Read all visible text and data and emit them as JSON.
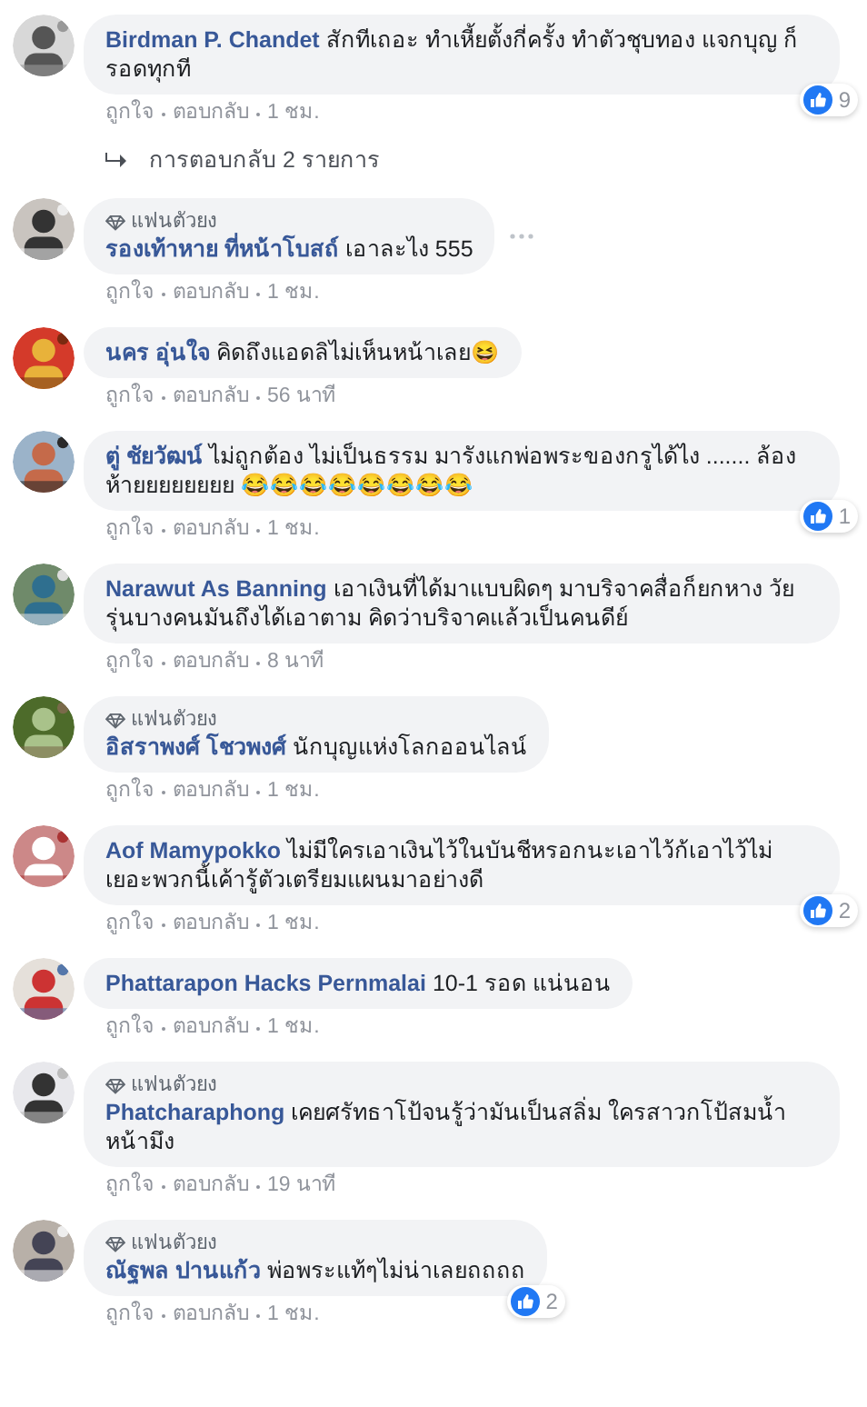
{
  "comments": [
    {
      "name": "Birdman P. Chandet",
      "text": "สักทีเถอะ ทำเหี้ยตั้งกี่ครั้ง ทำตัวชุบทอง แจกบุญ ก็รอดทุกที",
      "likes": "9",
      "options_visible": false,
      "actions": [
        "ถูกใจ",
        "ตอบกลับ",
        "1 ชม."
      ],
      "replies": "การตอบกลับ 2 รายการ"
    },
    {
      "fan_badge": "แฟนตัวยง",
      "name": "รองเท้าหาย ที่หน้าโบสถ์",
      "text": "เอาละไง 555",
      "options_visible": true,
      "actions": [
        "ถูกใจ",
        "ตอบกลับ",
        "1 ชม."
      ]
    },
    {
      "name": "นคร อุ่นใจ",
      "text": "คิดถึงแอดลิไม่เห็นหน้าเลย😆",
      "options_visible": false,
      "actions": [
        "ถูกใจ",
        "ตอบกลับ",
        "56 นาที"
      ]
    },
    {
      "name": "ตู่ ชัยวัฒน์",
      "text": "ไม่ถูกต้อง ไม่เป็นธรรม มารังแกพ่อพระของกรูได้ไง ....... ล้องห้ายยยยยยยย 😂😂😂😂😂😂😂😂",
      "likes": "1",
      "options_visible": false,
      "actions": [
        "ถูกใจ",
        "ตอบกลับ",
        "1 ชม."
      ]
    },
    {
      "name": "Narawut As Banning",
      "text": "เอาเงินที่ได้มาแบบผิดๆ มาบริจาคสื่อก็ยกหาง วัยรุ่นบางคนมันถึงได้เอาตาม คิดว่าบริจาคแล้วเป็นคนดีย์",
      "options_visible": false,
      "actions": [
        "ถูกใจ",
        "ตอบกลับ",
        "8 นาที"
      ]
    },
    {
      "fan_badge": "แฟนตัวยง",
      "name": "อิสราพงศ์ โชวพงศ์",
      "text": "นักบุญแห่งโลกออนไลน์",
      "options_visible": false,
      "actions": [
        "ถูกใจ",
        "ตอบกลับ",
        "1 ชม."
      ]
    },
    {
      "name": "Aof Mamypokko",
      "text": "ไม่มีใครเอาเงินไว้ในบันชีหรอกนะเอาไว้ก้เอาไว้ไม่เยอะพวกนี้เค้ารู้ตัวเตรียมแผนมาอย่างดี",
      "likes": "2",
      "options_visible": false,
      "actions": [
        "ถูกใจ",
        "ตอบกลับ",
        "1 ชม."
      ]
    },
    {
      "name": "Phattarapon Hacks Pernmalai",
      "text": "10-1 รอด แน่นอน",
      "options_visible": false,
      "actions": [
        "ถูกใจ",
        "ตอบกลับ",
        "1 ชม."
      ]
    },
    {
      "fan_badge": "แฟนตัวยง",
      "name": "Phatcharaphong",
      "text": "เคยศรัทธาโป้จนรู้ว่ามันเป็นสลิ่ม ใครสาวกโป้สมน้ำหน้ามึง",
      "options_visible": false,
      "actions": [
        "ถูกใจ",
        "ตอบกลับ",
        "19 นาที"
      ]
    },
    {
      "fan_badge": "แฟนตัวยง",
      "name": "ณัฐพล ปานแก้ว",
      "text": "พ่อพระแท้ๆไม่น่าเลยถถถถ",
      "likes": "2",
      "options_visible": false,
      "actions": [
        "ถูกใจ",
        "ตอบกลับ",
        "1 ชม."
      ]
    }
  ]
}
